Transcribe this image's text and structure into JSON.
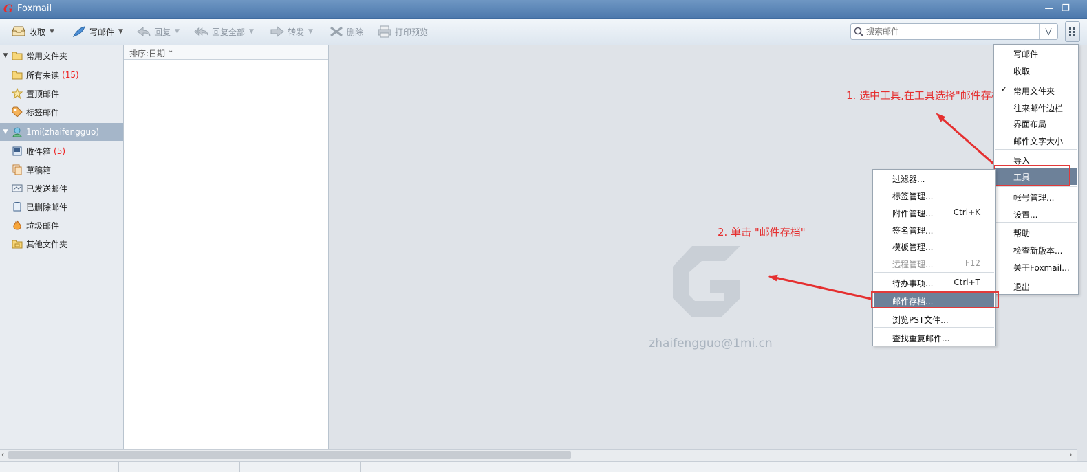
{
  "window": {
    "title": "Foxmail",
    "logo": "G"
  },
  "toolbar": {
    "receive": "收取",
    "compose": "写邮件",
    "reply": "回复",
    "reply_all": "回复全部",
    "forward": "转发",
    "delete": "删除",
    "print_preview": "打印预览"
  },
  "search": {
    "placeholder": "搜索邮件",
    "value": ""
  },
  "sidebar": {
    "favorites": {
      "label": "常用文件夹",
      "items": [
        {
          "label": "所有未读",
          "count": "(15)"
        },
        {
          "label": "置顶邮件"
        },
        {
          "label": "标签邮件"
        }
      ]
    },
    "account": {
      "label": "1mi(zhaifengguo)",
      "items": [
        {
          "label": "收件箱",
          "count": "(5)"
        },
        {
          "label": "草稿箱"
        },
        {
          "label": "已发送邮件"
        },
        {
          "label": "已删除邮件"
        },
        {
          "label": "垃圾邮件"
        },
        {
          "label": "其他文件夹"
        }
      ]
    }
  },
  "list": {
    "sort_label": "排序:日期"
  },
  "reading": {
    "watermark_email": "zhaifengguo@1mi.cn"
  },
  "main_menu": {
    "items": [
      {
        "label": "写邮件"
      },
      {
        "label": "收取"
      },
      {
        "label": "常用文件夹",
        "checked": true
      },
      {
        "label": "往来邮件边栏"
      },
      {
        "label": "界面布局"
      },
      {
        "label": "邮件文字大小"
      },
      {
        "label": "导入"
      },
      {
        "label": "工具",
        "highlighted": true
      },
      {
        "label": "帐号管理..."
      },
      {
        "label": "设置..."
      },
      {
        "label": "帮助"
      },
      {
        "label": "检查新版本..."
      },
      {
        "label": "关于Foxmail..."
      },
      {
        "label": "退出"
      }
    ]
  },
  "tools_menu": {
    "items": [
      {
        "label": "过滤器..."
      },
      {
        "label": "标签管理..."
      },
      {
        "label": "附件管理...",
        "shortcut": "Ctrl+K"
      },
      {
        "label": "签名管理..."
      },
      {
        "label": "模板管理..."
      },
      {
        "label": "远程管理...",
        "shortcut": "F12",
        "disabled": true
      },
      {
        "label": "待办事项...",
        "shortcut": "Ctrl+T"
      },
      {
        "label": "邮件存档...",
        "highlighted": true
      },
      {
        "label": "浏览PST文件..."
      },
      {
        "label": "查找重复邮件..."
      }
    ]
  },
  "annotations": {
    "step1": "1. 选中工具,在工具选择\"邮件存档\"",
    "step2": "2. 单击 \"邮件存档\""
  },
  "colors": {
    "accent_red": "#e53030",
    "title_bar": "#5a84b6",
    "menu_highlight": "#6d8199",
    "unread_count": "#e22222"
  }
}
